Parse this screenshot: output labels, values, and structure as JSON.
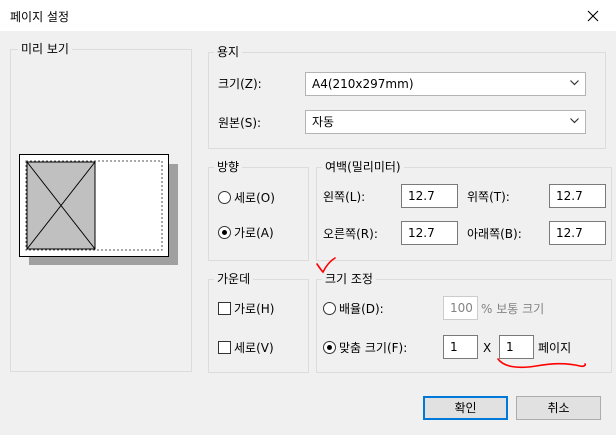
{
  "window": {
    "title": "페이지 설정"
  },
  "preview": {
    "legend": "미리 보기"
  },
  "paper": {
    "legend": "용지",
    "size_label": "크기(Z):",
    "size_value": "A4(210x297mm)",
    "source_label": "원본(S):",
    "source_value": "자동"
  },
  "orientation": {
    "legend": "방향",
    "portrait_label": "세로(O)",
    "landscape_label": "가로(A)",
    "selected": "landscape"
  },
  "margins": {
    "legend": "여백(밀리미터)",
    "left_label": "왼쪽(L):",
    "left_value": "12.7",
    "top_label": "위쪽(T):",
    "top_value": "12.7",
    "right_label": "오른쪽(R):",
    "right_value": "12.7",
    "bottom_label": "아래쪽(B):",
    "bottom_value": "12.7"
  },
  "center": {
    "legend": "가운데",
    "horizontal_label": "가로(H)",
    "vertical_label": "세로(V)"
  },
  "scaling": {
    "legend": "크기 조정",
    "scale_label": "배율(D):",
    "scale_value": "100",
    "scale_suffix": "% 보통 크기",
    "fit_label": "맞춤 크기(F):",
    "fit_wide_value": "1",
    "times": "X",
    "fit_tall_value": "1",
    "pages_label": "페이지",
    "selected": "fit"
  },
  "buttons": {
    "ok": "확인",
    "cancel": "취소"
  },
  "colors": {
    "accent": "#0078d7",
    "annotation": "#ff0000"
  }
}
